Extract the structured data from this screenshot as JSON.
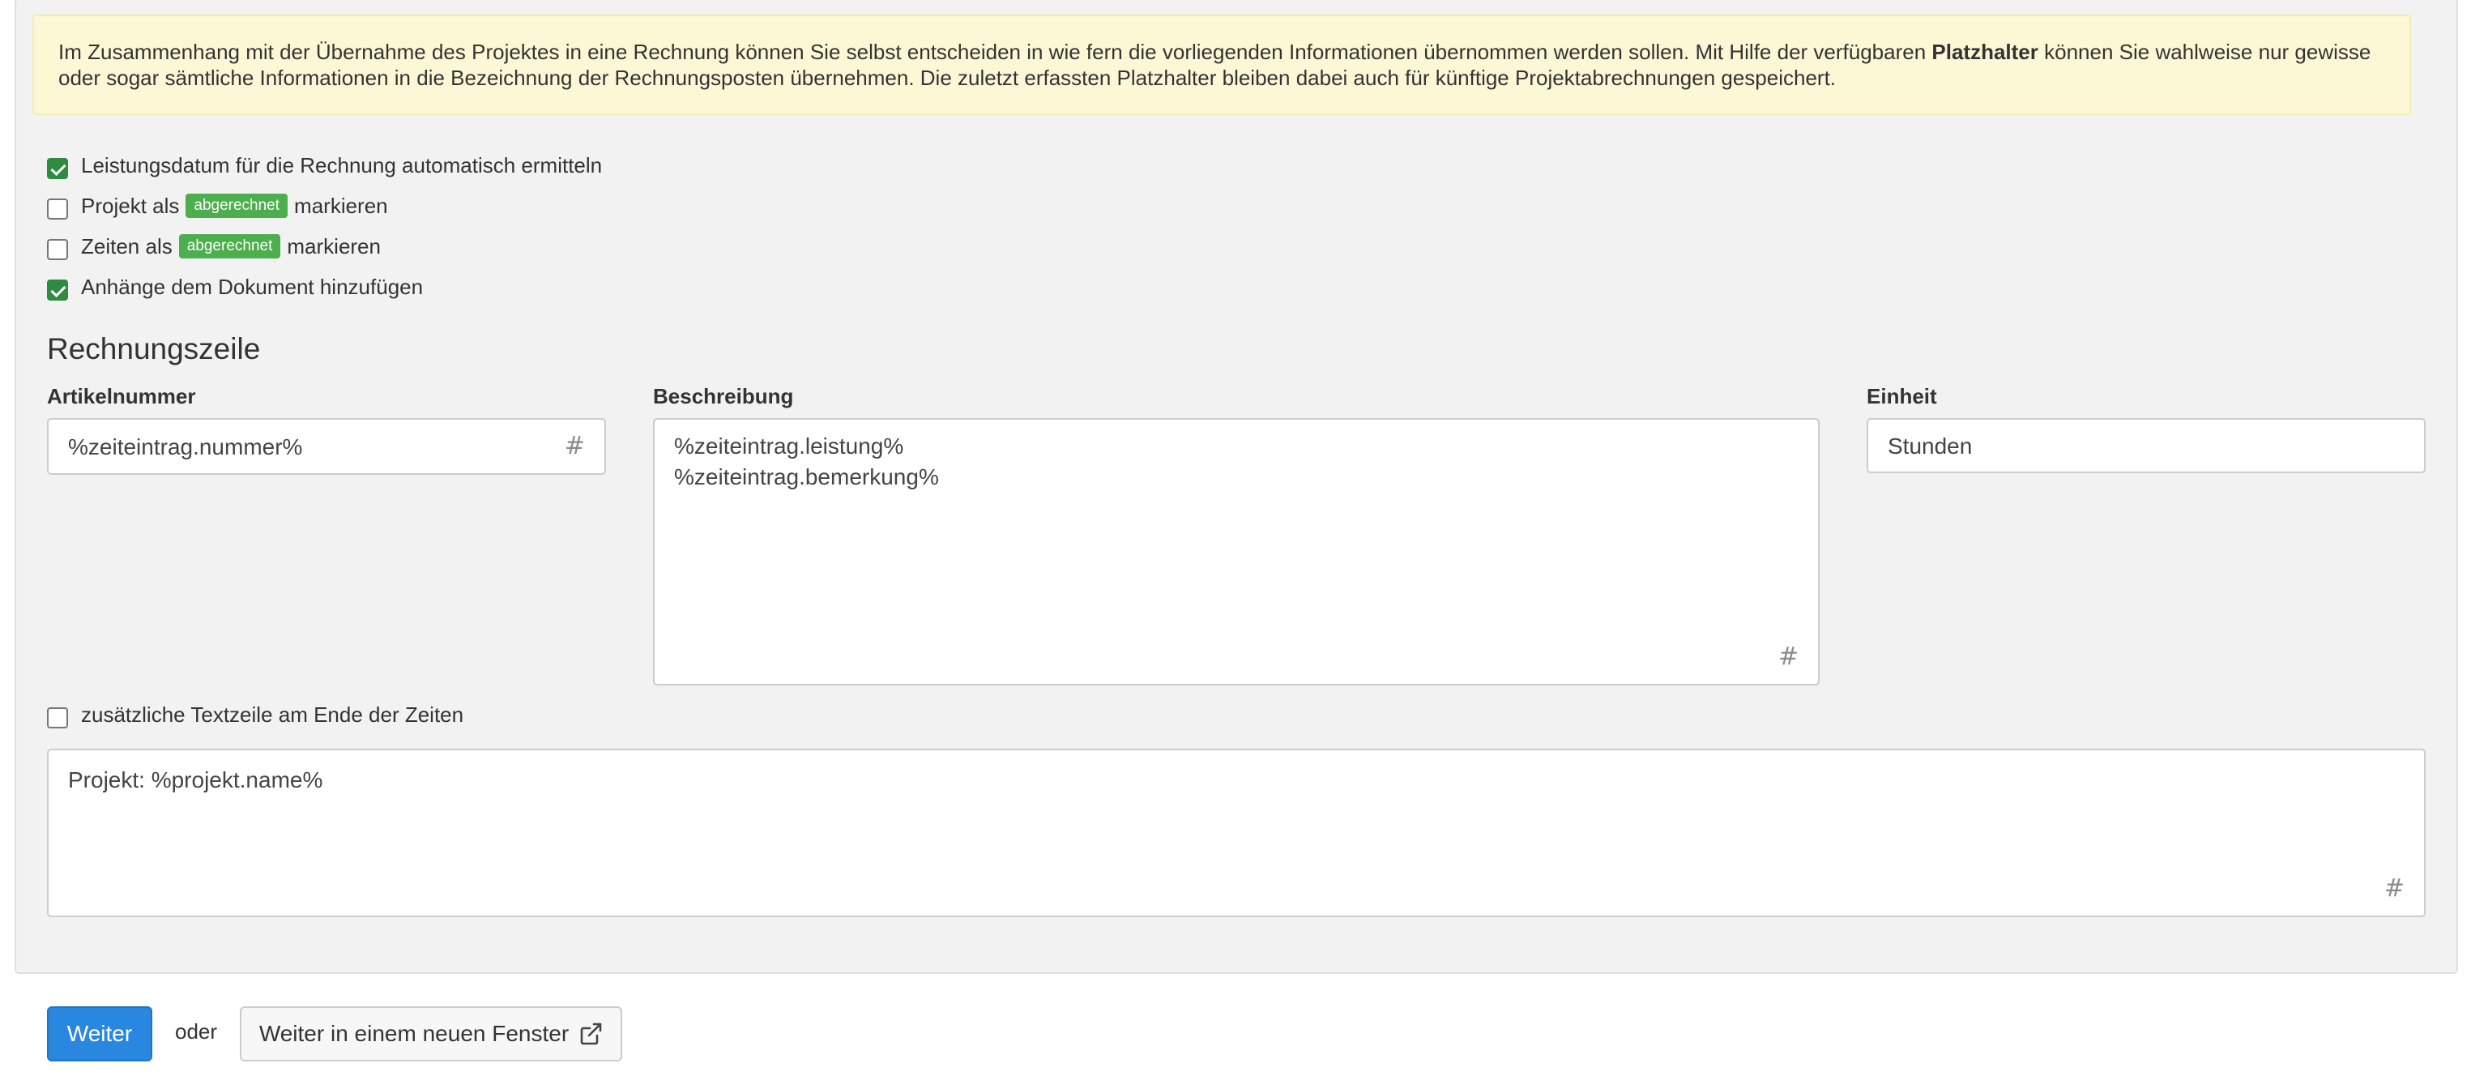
{
  "info": {
    "text_before": "Im Zusammenhang mit der Übernahme des Projektes in eine Rechnung können Sie selbst entscheiden in wie fern die vorliegenden Informationen übernommen werden sollen. Mit Hilfe der verfügbaren ",
    "bold": "Platzhalter",
    "text_after": " können Sie wahlweise nur gewisse oder sogar sämtliche Informationen in die Bezeichnung der Rechnungsposten übernehmen. Die zuletzt erfassten Platzhalter bleiben dabei auch für künftige Projektabrechnungen gespeichert."
  },
  "options": {
    "leistungsdatum": {
      "label": "Leistungsdatum für die Rechnung automatisch ermitteln",
      "checked": true
    },
    "projekt": {
      "prefix": "Projekt als",
      "badge": "abgerechnet",
      "suffix": "markieren",
      "checked": false
    },
    "zeiten": {
      "prefix": "Zeiten als",
      "badge": "abgerechnet",
      "suffix": "markieren",
      "checked": false
    },
    "anhaenge": {
      "label": "Anhänge dem Dokument hinzufügen",
      "checked": true
    },
    "zusatz": {
      "label": "zusätzliche Textzeile am Ende der Zeiten",
      "checked": false
    }
  },
  "section": {
    "title": "Rechnungszeile"
  },
  "fields": {
    "artikelnummer": {
      "label": "Artikelnummer",
      "value": "%zeiteintrag.nummer%"
    },
    "beschreibung": {
      "label": "Beschreibung",
      "line1": "%zeiteintrag.leistung%",
      "line2": "%zeiteintrag.bemerkung%"
    },
    "einheit": {
      "label": "Einheit",
      "value": "Stunden"
    },
    "zusatztext": {
      "value": "Projekt: %projekt.name%"
    },
    "placeholder_symbol": "#"
  },
  "actions": {
    "weiter": "Weiter",
    "oder": "oder",
    "weiter_neu": "Weiter in einem neuen Fenster"
  },
  "colors": {
    "badge": "#4cae4c",
    "primary": "#2a87e0",
    "checkbox_checked": "#2e8b3f",
    "info_bg": "#fcf8d6"
  },
  "icons": {
    "placeholder": "hash-icon",
    "new_window": "external-link-icon"
  }
}
